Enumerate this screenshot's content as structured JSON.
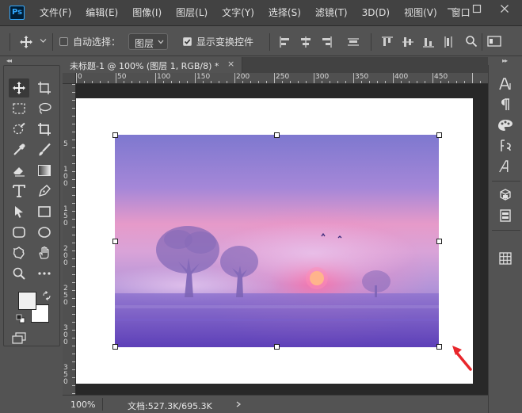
{
  "app": {
    "logo_text": "Ps"
  },
  "menu": {
    "items": [
      "文件(F)",
      "编辑(E)",
      "图像(I)",
      "图层(L)",
      "文字(Y)",
      "选择(S)",
      "滤镜(T)",
      "3D(D)",
      "视图(V)",
      "窗口"
    ]
  },
  "options": {
    "auto_select_label": "自动选择：",
    "auto_select_checked": false,
    "layer_select_value": "图层",
    "show_transform_label": "显示变换控件",
    "show_transform_checked": true
  },
  "document": {
    "tab_label": "未标题-1 @ 100% (图层 1, RGB/8) *",
    "close_glyph": "×"
  },
  "rulers": {
    "horizontal": [
      "0",
      "50",
      "100",
      "150",
      "200",
      "250",
      "300",
      "350",
      "400",
      "450"
    ],
    "vertical": [
      "5",
      "1\n0\n0",
      "1\n5\n0",
      "2\n0\n0",
      "2\n5\n0",
      "3\n0\n0",
      "3\n5\n0"
    ]
  },
  "status": {
    "zoom": "100%",
    "doc_size": "文档:527.3K/695.3K"
  },
  "colors": {
    "accent": "#31a8ff",
    "foreground_swatch": "#f0f0f0",
    "background_swatch": "#ffffff",
    "annotation_arrow": "#e8262b"
  },
  "icons": {
    "toolbar": [
      "move-icon",
      "artboard-icon",
      "marquee-icon",
      "lasso-icon",
      "quick-select-icon",
      "crop-icon",
      "eyedropper-icon",
      "brush-icon",
      "eraser-icon",
      "gradient-icon",
      "type-icon",
      "pen-icon",
      "path-select-icon",
      "rectangle-icon",
      "rounded-rect-icon",
      "ellipse-icon",
      "custom-shape-icon",
      "hand-icon",
      "zoom-icon",
      "more-tools-icon"
    ],
    "right_panel": [
      "character-icon",
      "paragraph-icon",
      "color-icon",
      "glyphs-icon",
      "character-styles-icon",
      "3d-icon",
      "layers-comp-icon",
      "grid-icon"
    ]
  }
}
